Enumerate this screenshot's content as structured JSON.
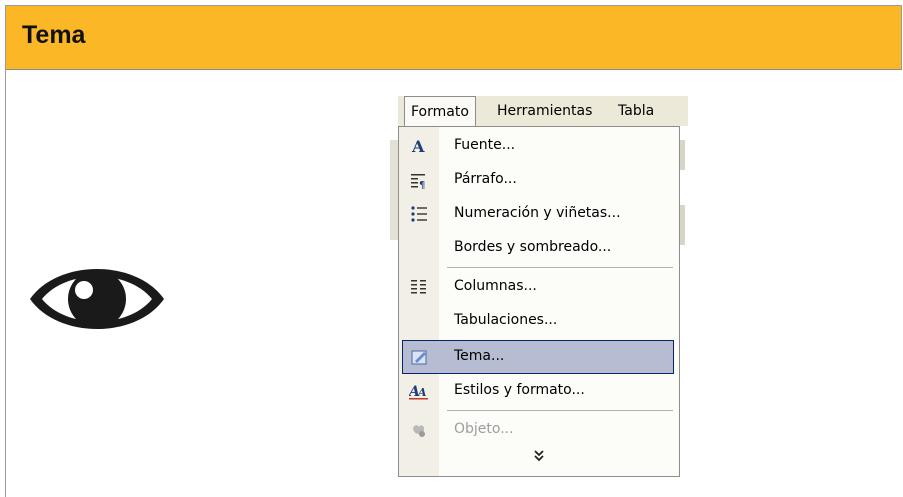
{
  "header": {
    "title": "Tema"
  },
  "menubar": {
    "items": [
      "Formato",
      "Herramientas",
      "Tabla"
    ]
  },
  "menu": {
    "items": [
      {
        "label": "Fuente...",
        "icon": "font-A-icon"
      },
      {
        "label": "Párrafo...",
        "icon": "paragraph-icon"
      },
      {
        "label": "Numeración y viñetas...",
        "icon": "list-bullets-icon"
      },
      {
        "label": "Bordes y sombreado...",
        "icon": ""
      },
      {
        "label": "Columnas...",
        "icon": "columns-icon"
      },
      {
        "label": "Tabulaciones...",
        "icon": ""
      },
      {
        "label": "Tema...",
        "icon": "theme-icon",
        "highlighted": true
      },
      {
        "label": "Estilos y formato...",
        "icon": "styles-icon"
      },
      {
        "label": "Objeto...",
        "icon": "object-icon",
        "disabled": true
      }
    ],
    "expand_icon": "double-chevron-down-icon"
  },
  "colors": {
    "header_bg": "#fbb725",
    "highlight_bg": "#b6bdd2",
    "highlight_border": "#0a246a"
  }
}
